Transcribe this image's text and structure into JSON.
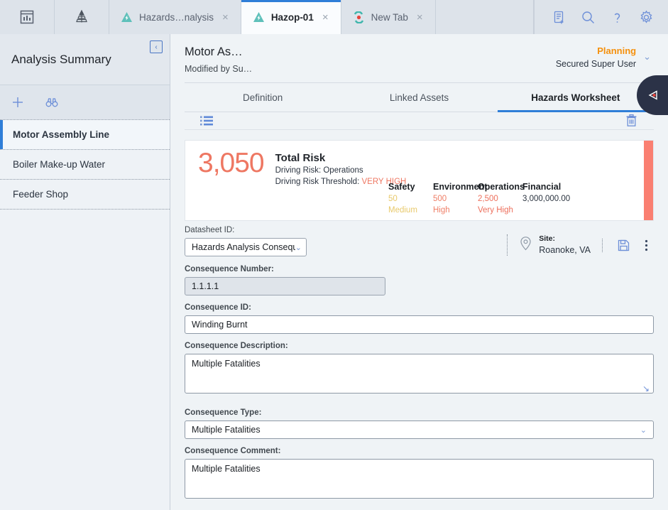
{
  "topbar": {
    "icons": [
      {
        "name": "dashboard-icon",
        "glyph": "chart"
      },
      {
        "name": "hierarchy-icon",
        "glyph": "pyramid"
      }
    ],
    "tabs": [
      {
        "label": "Hazards…nalysis",
        "icon": "hazard-analysis-icon",
        "active": false,
        "close": "×"
      },
      {
        "label": "Hazop-01",
        "icon": "hazard-analysis-icon",
        "active": true,
        "close": "×"
      },
      {
        "label": "New Tab",
        "icon": "new-tab-icon",
        "active": false,
        "close": "×"
      }
    ],
    "actions": [
      {
        "name": "new-document-icon"
      },
      {
        "name": "search-icon"
      },
      {
        "name": "help-icon"
      },
      {
        "name": "settings-icon"
      }
    ]
  },
  "sidebar": {
    "title": "Analysis Summary",
    "collapse_glyph": "‹",
    "tools": [
      {
        "name": "add-icon"
      },
      {
        "name": "binoculars-icon"
      }
    ],
    "items": [
      {
        "label": "Motor Assembly Line",
        "active": true
      },
      {
        "label": "Boiler Make-up Water",
        "active": false
      },
      {
        "label": "Feeder Shop",
        "active": false
      }
    ]
  },
  "page": {
    "title": "Motor As…",
    "subtitle": "Modified by Su…",
    "status": "Planning",
    "user": "Secured Super User",
    "status_chevron": "⌄"
  },
  "tabs": [
    {
      "label": "Definition",
      "active": false
    },
    {
      "label": "Linked Assets",
      "active": false
    },
    {
      "label": "Hazards Worksheet",
      "active": true
    }
  ],
  "worksheet_toolbar": {
    "list_icon": "list-view-icon",
    "delete_icon": "delete-icon"
  },
  "risk": {
    "total": "3,050",
    "total_label": "Total Risk",
    "driving_risk_label": "Driving Risk:",
    "driving_risk_value": "Operations",
    "threshold_label": "Driving Risk Threshold:",
    "threshold_value": "VERY HIGH",
    "accent_color": "#fa7f71",
    "total_color": "#ee7762",
    "categories": [
      {
        "header": "Safety",
        "value": "50",
        "level": "Medium",
        "color": "#e8c96b"
      },
      {
        "header": "Environment",
        "value": "500",
        "level": "High",
        "color": "#ef7f67"
      },
      {
        "header": "Operations",
        "value": "2,500",
        "level": "Very High",
        "color": "#ed6f5c"
      },
      {
        "header": "Financial",
        "value": "3,000,000.00",
        "level": "",
        "color": "#2b3440"
      }
    ]
  },
  "datasheet": {
    "label": "Datasheet ID:",
    "selected": "Hazards Analysis Consequenc",
    "chevron": "⌄",
    "site_label": "Site:",
    "site_value": "Roanoke, VA",
    "location_icon": "location-pin-icon",
    "save_icon": "save-icon",
    "more_icon": "more-vertical-icon"
  },
  "form": {
    "consequence_number": {
      "label": "Consequence Number:",
      "value": "1.1.1.1",
      "readonly": true
    },
    "consequence_id": {
      "label": "Consequence ID:",
      "value": "Winding Burnt"
    },
    "consequence_description": {
      "label": "Consequence Description:",
      "value": "Multiple Fatalities",
      "resize_glyph": "↘"
    },
    "consequence_type": {
      "label": "Consequence Type:",
      "value": "Multiple Fatalities",
      "chevron": "⌄"
    },
    "consequence_comment": {
      "label": "Consequence Comment:",
      "value": "Multiple Fatalities"
    }
  },
  "drawer": {
    "name": "side-panel-toggle"
  }
}
